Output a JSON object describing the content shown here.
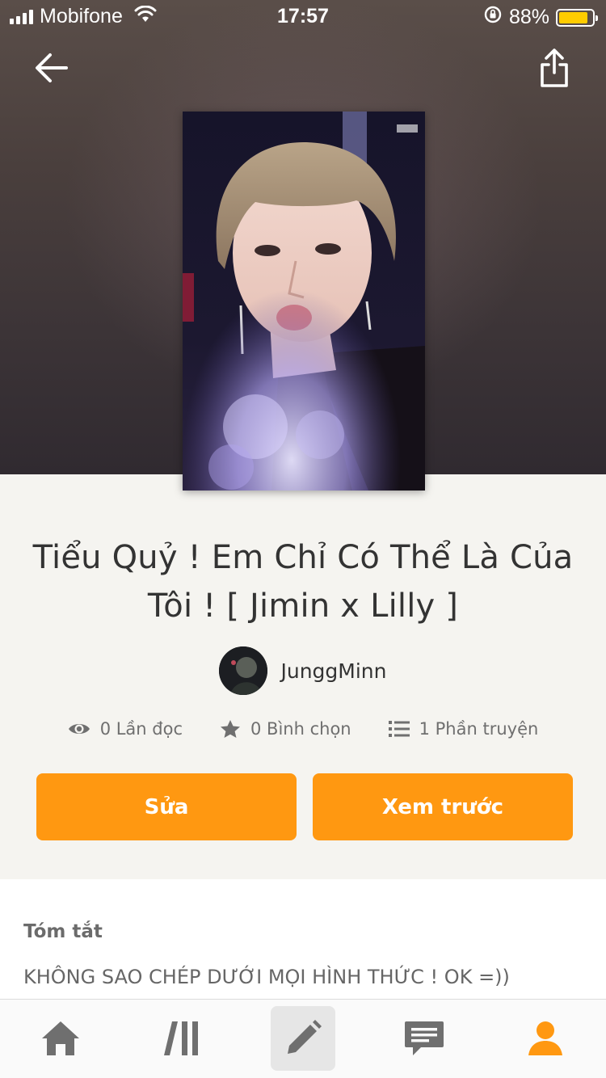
{
  "status_bar": {
    "carrier": "Mobifone",
    "time": "17:57",
    "battery_percent": "88%",
    "battery_level": 0.88
  },
  "header": {
    "back_icon": "arrow-left-icon",
    "share_icon": "share-icon"
  },
  "story": {
    "title": "Tiểu Quỷ ! Em Chỉ Có Thể Là Của Tôi ! [ Jimin x Lilly ]",
    "author": "JunggMinn",
    "stats": {
      "reads": "0 Lần đọc",
      "votes": "0 Bình chọn",
      "parts": "1 Phần truyện"
    }
  },
  "actions": {
    "edit_label": "Sửa",
    "preview_label": "Xem trước"
  },
  "summary": {
    "heading": "Tóm tắt",
    "text": "KHÔNG SAO CHÉP DƯỚI MỌI HÌNH THỨC ! OK =))"
  },
  "bottom_nav": {
    "items": [
      "home-icon",
      "library-icon",
      "write-icon",
      "messages-icon",
      "profile-icon"
    ],
    "active": "write-icon",
    "accent": "#ff9811"
  },
  "colors": {
    "accent": "#ff9811",
    "background": "#f5f4f0"
  }
}
